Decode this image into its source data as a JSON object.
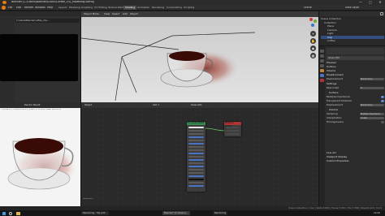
{
  "window": {
    "title": "Blender [C:\\Users\\Blender\\Dunc\\Coffee_03\\_Modeling.blend]",
    "controls": [
      "—",
      "▢",
      "✕"
    ]
  },
  "menu": {
    "items": [
      "File",
      "Edit",
      "Render",
      "Window",
      "Help"
    ]
  },
  "workspaces": [
    "Layout",
    "Modeling",
    "Sculpting",
    "UV Editing",
    "Texture Paint",
    "Shading",
    "Animation",
    "Rendering",
    "Compositing",
    "Scripting"
  ],
  "active_workspace": "Shading",
  "scene": {
    "label": "Scene",
    "view_layer": "View Layer"
  },
  "file_browser": {
    "path": "C:\\Users\\Blender\\coffee_ima..."
  },
  "viewport": {
    "mode": "Object Mode",
    "view": "View",
    "select": "Select",
    "add": "Add",
    "object": "Object"
  },
  "render_view": {
    "slot": "Render Result",
    "info": "Frame:1 | Time:00:24.35 | Mem:174.30M, Peak 195.97M"
  },
  "node_editor": {
    "object": "Object",
    "slot": "Slot 1",
    "material": "Glass.001",
    "footer": "Glass.001",
    "bsdf_title": "Principled BSDF",
    "output_title": "Material Output"
  },
  "outliner": {
    "rows": [
      "Scene Collection",
      "Collection",
      "Plane",
      "Camera",
      "Light",
      "Cup",
      "Coffee"
    ]
  },
  "properties": {
    "material_name": "Glass.001",
    "sections": [
      "Preview",
      "Surface",
      "Volume",
      "Displacement",
      "Settings",
      "Volume",
      "Line Art",
      "Viewport Display",
      "Custom Properties"
    ],
    "rows": [
      {
        "label": "Displacement",
        "value": "Bump Only"
      },
      {
        "label": "Pass Index",
        "value": "0"
      },
      {
        "label": "Multiple Importance",
        "value": "✔"
      },
      {
        "label": "Transparent Shadows",
        "value": "✔"
      },
      {
        "label": "Displacement",
        "value": "Bump Only"
      },
      {
        "label": "Sampling",
        "value": "Multiple Importance"
      },
      {
        "label": "Interpolation",
        "value": "Linear"
      },
      {
        "label": "Homogeneous",
        "value": ""
      }
    ]
  },
  "status": {
    "text": "Scene Collection | Cup | Verts:3,826 | Faces:3,700 | Tris:7,396 | Objects:1/4 | 3.0.0"
  },
  "taskbar": {
    "items": [
      "Rendering - My pict...",
      "Blender* [C:\\Users\\...",
      "Rendering"
    ],
    "clock": "14:52"
  },
  "colors": {
    "accent_selection": "#334d80",
    "node_shader_header": "#3a8a52",
    "node_output_header": "#b03434",
    "coffee": "#3a0a06",
    "shadow": "#9e3f32"
  }
}
